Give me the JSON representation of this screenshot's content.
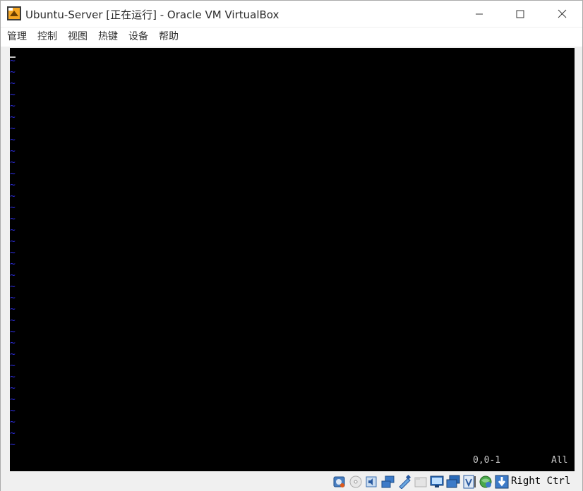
{
  "window": {
    "title": "Ubuntu-Server [正在运行] - Oracle VM VirtualBox",
    "app_icon": "virtualbox-icon"
  },
  "menu": {
    "items": [
      "管理",
      "控制",
      "视图",
      "热键",
      "设备",
      "帮助"
    ]
  },
  "console": {
    "tilde_char": "~",
    "status_position": "0,0-1",
    "status_scope": "All"
  },
  "statusbar": {
    "icons": [
      "hard-disk-icon",
      "optical-drive-icon",
      "audio-icon",
      "network-icon",
      "usb-icon",
      "shared-folder-icon",
      "display-icon",
      "video-capture-icon",
      "virtualization-icon",
      "guest-additions-icon",
      "mouse-integration-icon"
    ],
    "host_key": "Right Ctrl"
  },
  "colors": {
    "console_bg": "#000000",
    "tilde": "#2a2ad8",
    "status_text": "#c8c8c8"
  }
}
